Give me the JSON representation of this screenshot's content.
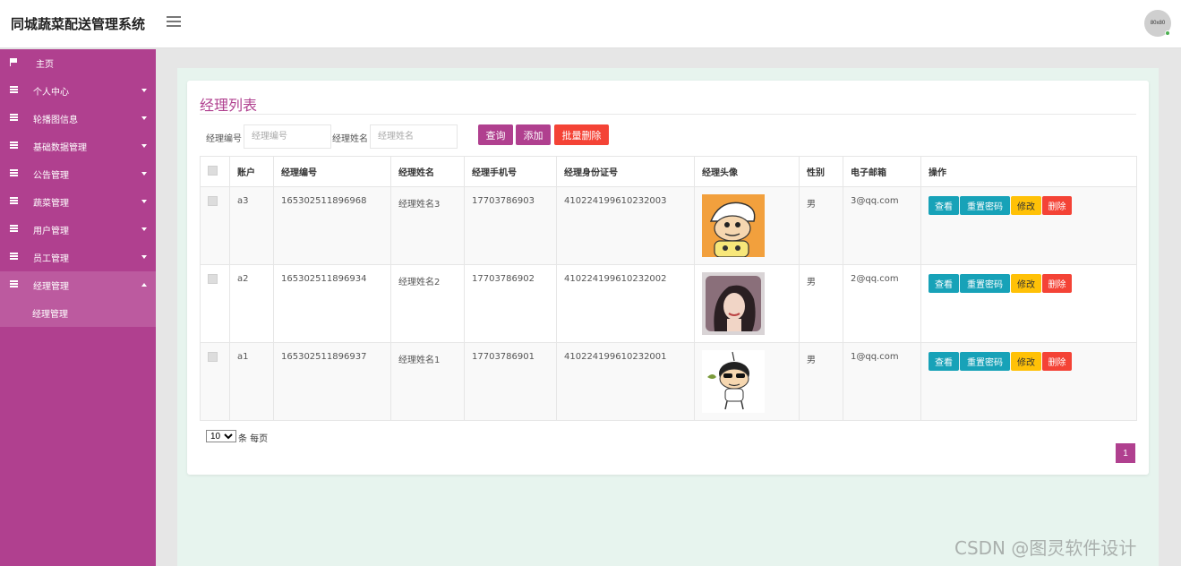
{
  "header": {
    "app_title": "同城蔬菜配送管理系统",
    "avatar_text": "80x80"
  },
  "sidebar": {
    "items": [
      {
        "label": "主页",
        "icon": "flag-icon"
      },
      {
        "label": "个人中心",
        "icon": "grid-icon"
      },
      {
        "label": "轮播图信息",
        "icon": "grid-icon"
      },
      {
        "label": "基础数据管理",
        "icon": "grid-icon"
      },
      {
        "label": "公告管理",
        "icon": "grid-icon"
      },
      {
        "label": "蔬菜管理",
        "icon": "grid-icon"
      },
      {
        "label": "用户管理",
        "icon": "grid-icon"
      },
      {
        "label": "员工管理",
        "icon": "grid-icon"
      },
      {
        "label": "经理管理",
        "icon": "grid-icon"
      }
    ],
    "sub_items": [
      {
        "label": "经理管理"
      }
    ]
  },
  "main": {
    "page_title": "经理列表",
    "search": {
      "code_label": "经理编号",
      "code_placeholder": "经理编号",
      "name_label": "经理姓名",
      "name_placeholder": "经理姓名",
      "query_btn": "查询",
      "add_btn": "添加",
      "batch_delete_btn": "批量删除"
    },
    "table": {
      "headers": [
        "账户",
        "经理编号",
        "经理姓名",
        "经理手机号",
        "经理身份证号",
        "经理头像",
        "性别",
        "电子邮箱",
        "操作"
      ],
      "rows": [
        {
          "account": "a3",
          "code": "165302511896968",
          "name": "经理姓名3",
          "phone": "17703786903",
          "id_card": "410224199610232003",
          "avatar": "cartoon-boy-hat",
          "gender": "男",
          "email": "3@qq.com"
        },
        {
          "account": "a2",
          "code": "165302511896934",
          "name": "经理姓名2",
          "phone": "17703786902",
          "id_card": "410224199610232002",
          "avatar": "woman-portrait",
          "gender": "男",
          "email": "2@qq.com"
        },
        {
          "account": "a1",
          "code": "165302511896937",
          "name": "经理姓名1",
          "phone": "17703786901",
          "id_card": "410224199610232001",
          "avatar": "cartoon-boy-sunglasses",
          "gender": "男",
          "email": "1@qq.com"
        }
      ],
      "actions": {
        "view": "查看",
        "reset": "重置密码",
        "edit": "修改",
        "delete": "删除"
      }
    },
    "pagination": {
      "page_size": "10",
      "page_size_label": "条 每页",
      "current_page": "1"
    }
  },
  "watermark": "CSDN @图灵软件设计",
  "colors": {
    "primary": "#b0408f",
    "danger": "#f44336",
    "info": "#17a2b8",
    "warning": "#ffc107",
    "content_bg": "#e7f4ee"
  }
}
